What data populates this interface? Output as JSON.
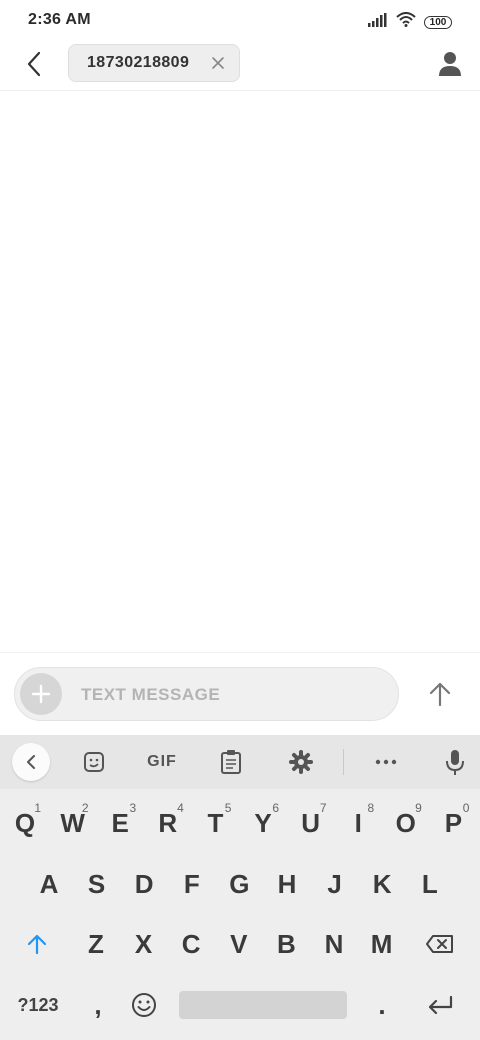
{
  "status_bar": {
    "time": "2:36 AM",
    "battery": "100"
  },
  "header": {
    "recipient": "18730218809"
  },
  "compose": {
    "placeholder": "TEXT MESSAGE"
  },
  "keyboard": {
    "toolbar": {
      "gif_label": "GIF"
    },
    "row1": [
      {
        "key": "Q",
        "hint": "1"
      },
      {
        "key": "W",
        "hint": "2"
      },
      {
        "key": "E",
        "hint": "3"
      },
      {
        "key": "R",
        "hint": "4"
      },
      {
        "key": "T",
        "hint": "5"
      },
      {
        "key": "Y",
        "hint": "6"
      },
      {
        "key": "U",
        "hint": "7"
      },
      {
        "key": "I",
        "hint": "8"
      },
      {
        "key": "O",
        "hint": "9"
      },
      {
        "key": "P",
        "hint": "0"
      }
    ],
    "row2": [
      "A",
      "S",
      "D",
      "F",
      "G",
      "H",
      "J",
      "K",
      "L"
    ],
    "row3": [
      "Z",
      "X",
      "C",
      "V",
      "B",
      "N",
      "M"
    ],
    "row4": {
      "symbols": "?123",
      "comma": ",",
      "period": "."
    }
  }
}
